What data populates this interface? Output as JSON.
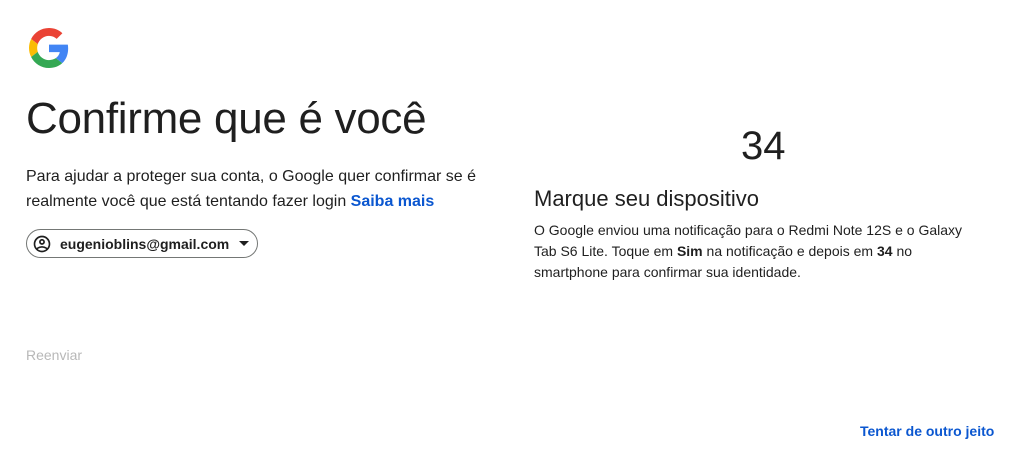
{
  "header": {
    "logo_icon": "google-g-logo"
  },
  "main": {
    "title": "Confirme que é você",
    "subtitle_text": "Para ajudar a proteger sua conta, o Google quer confirmar se é realmente você que está tentando fazer login ",
    "learn_more_link": "Saiba mais",
    "account": {
      "icon": "account-circle-icon",
      "email": "eugenioblins@gmail.com",
      "dropdown_icon": "caret-down-icon"
    },
    "resend_label": "Reenviar"
  },
  "challenge": {
    "number": "34",
    "heading": "Marque seu dispositivo",
    "description": {
      "part1": "O Google enviou uma notificação para o Redmi Note 12S e o Galaxy Tab S6 Lite. Toque em ",
      "bold1": "Sim",
      "part2": " na notificação e depois em ",
      "bold2": "34",
      "part3": " no smartphone para confirmar sua identidade."
    }
  },
  "footer": {
    "try_another_way": "Tentar de outro jeito"
  },
  "colors": {
    "link_blue": "#0b57d0",
    "text": "#1f1f1f",
    "disabled": "#b8b8b8",
    "google_blue": "#4285F4",
    "google_red": "#EA4335",
    "google_yellow": "#FBBC05",
    "google_green": "#34A853"
  }
}
